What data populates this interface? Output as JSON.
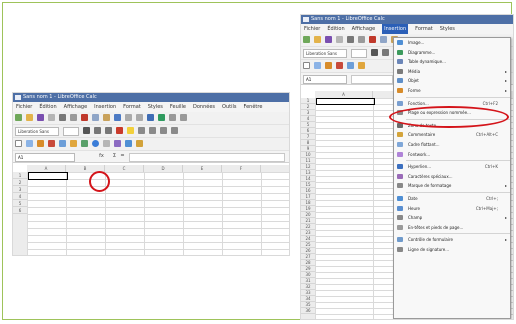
{
  "left": {
    "window_title": "Sans nom 1 - LibreOffice Calc",
    "menu": [
      "Fichier",
      "Édition",
      "Affichage",
      "Insertion",
      "Format",
      "Styles",
      "Feuille",
      "Données",
      "Outils",
      "Fenêtre"
    ],
    "font_name": "Liberation Sans",
    "name_box": "A1",
    "fx_label": "fx",
    "sigma_label": "Σ",
    "equals_label": "=",
    "columns": [
      "A",
      "B",
      "C",
      "D",
      "E",
      "F"
    ],
    "rows": [
      "1",
      "2",
      "3",
      "4",
      "5",
      "6"
    ]
  },
  "right": {
    "window_title": "Sans nom 1 - LibreOffice Calc",
    "menu": [
      "Fichier",
      "Édition",
      "Affichage",
      "Insertion",
      "Format",
      "Styles"
    ],
    "active_menu": "Insertion",
    "font_name": "Liberation Sans",
    "name_box": "A1",
    "columns": [
      "A",
      "B"
    ],
    "rows": [
      "1",
      "2",
      "3",
      "4",
      "5",
      "6",
      "7",
      "8",
      "9",
      "10",
      "11",
      "12",
      "13",
      "14",
      "15",
      "16",
      "17",
      "18",
      "19",
      "20",
      "21",
      "22",
      "23",
      "24",
      "25",
      "26",
      "27",
      "28",
      "29",
      "30",
      "31",
      "32",
      "33",
      "34",
      "35",
      "36"
    ],
    "insert_menu": [
      {
        "label": "Image...",
        "shortcut": "",
        "arrow": false,
        "sep_after": false
      },
      {
        "label": "Diagramme...",
        "shortcut": "",
        "arrow": false,
        "sep_after": false
      },
      {
        "label": "Table dynamique...",
        "shortcut": "",
        "arrow": false,
        "sep_after": false
      },
      {
        "label": "Média",
        "shortcut": "",
        "arrow": true,
        "sep_after": false
      },
      {
        "label": "Objet",
        "shortcut": "",
        "arrow": true,
        "sep_after": false
      },
      {
        "label": "Forme",
        "shortcut": "",
        "arrow": true,
        "sep_after": true
      },
      {
        "label": "Fonction...",
        "shortcut": "Ctrl+F2",
        "arrow": false,
        "sep_after": false
      },
      {
        "label": "Plage ou expression nommée...",
        "shortcut": "",
        "arrow": false,
        "sep_after": true
      },
      {
        "label": "Zone de texte",
        "shortcut": "",
        "arrow": false,
        "sep_after": false
      },
      {
        "label": "Commentaire",
        "shortcut": "Ctrl+Alt+C",
        "arrow": false,
        "sep_after": false
      },
      {
        "label": "Cadre flottant...",
        "shortcut": "",
        "arrow": false,
        "sep_after": false
      },
      {
        "label": "Fontwork...",
        "shortcut": "",
        "arrow": false,
        "sep_after": true
      },
      {
        "label": "Hyperlien...",
        "shortcut": "Ctrl+K",
        "arrow": false,
        "sep_after": false
      },
      {
        "label": "Caractères spéciaux...",
        "shortcut": "",
        "arrow": false,
        "sep_after": false
      },
      {
        "label": "Marque de formatage",
        "shortcut": "",
        "arrow": true,
        "sep_after": true
      },
      {
        "label": "Date",
        "shortcut": "Ctrl+;",
        "arrow": false,
        "sep_after": false
      },
      {
        "label": "Heure",
        "shortcut": "Ctrl+Maj+;",
        "arrow": false,
        "sep_after": false
      },
      {
        "label": "Champ",
        "shortcut": "",
        "arrow": true,
        "sep_after": false
      },
      {
        "label": "En-têtes et pieds de page...",
        "shortcut": "",
        "arrow": false,
        "sep_after": true
      },
      {
        "label": "Contrôle de formulaire",
        "shortcut": "",
        "arrow": true,
        "sep_after": false
      },
      {
        "label": "Ligne de signature...",
        "shortcut": "",
        "arrow": false,
        "sep_after": false
      }
    ]
  },
  "colors": {
    "titlebar": "#4d6fa6",
    "highlight": "#2b5fb7",
    "annotation": "#d4141a",
    "frame": "#9ec35a"
  }
}
